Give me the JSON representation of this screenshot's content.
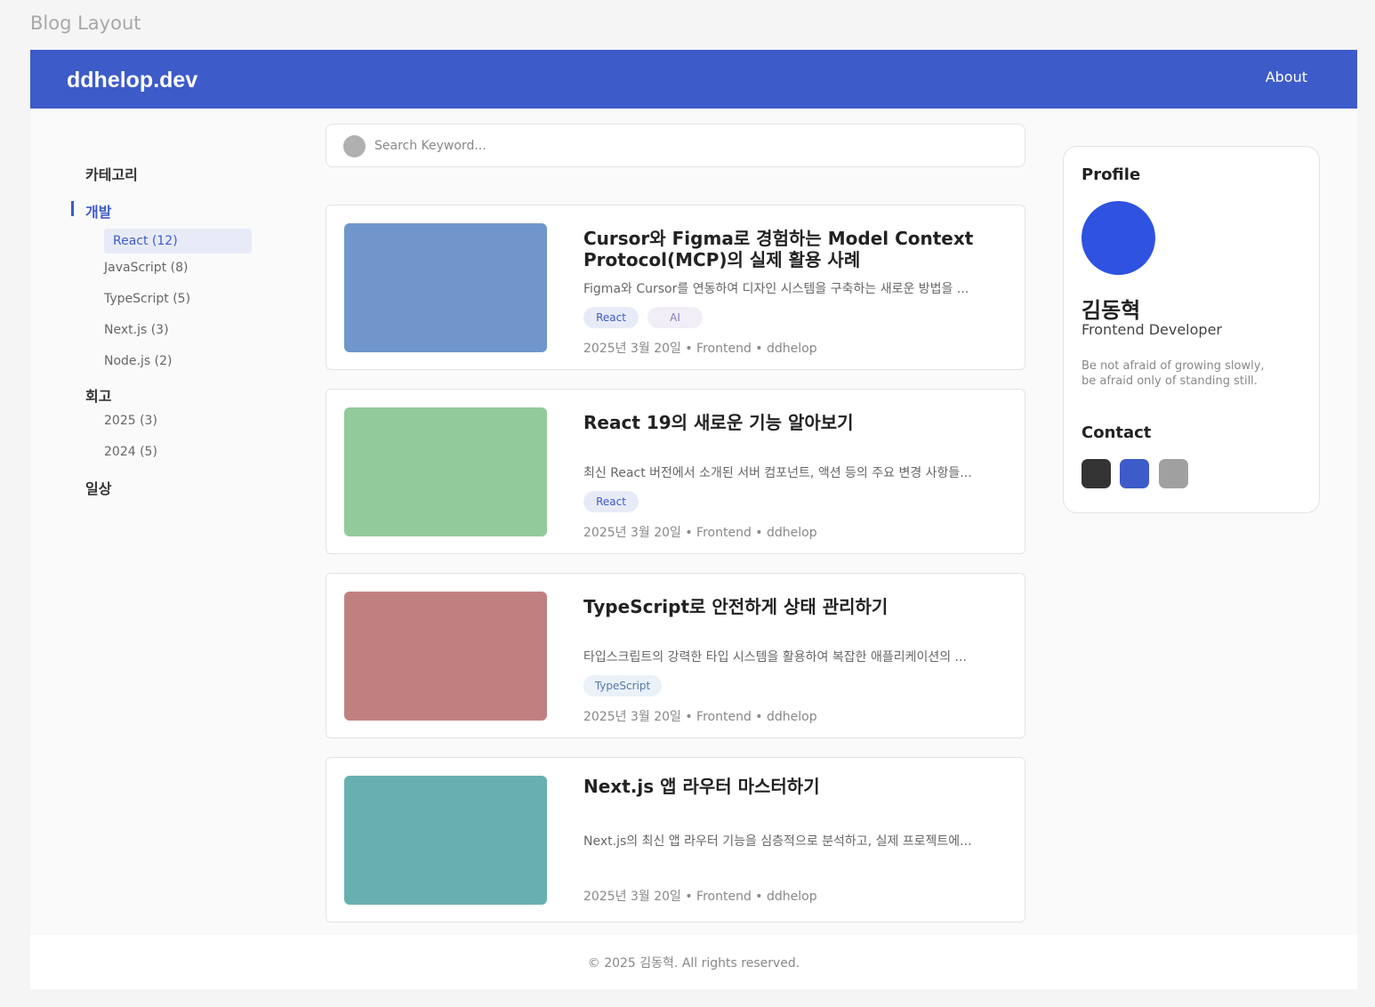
{
  "frame_title": "Blog Layout",
  "header": {
    "logo": "ddhelop.dev",
    "nav_about": "About",
    "color": "#3d5bc9"
  },
  "sidebar": {
    "title": "카테고리",
    "groups": [
      {
        "label": "개발",
        "active": true,
        "items": [
          {
            "label": "React (12)",
            "active": true
          },
          {
            "label": "JavaScript (8)"
          },
          {
            "label": "TypeScript (5)"
          },
          {
            "label": "Next.js (3)"
          },
          {
            "label": "Node.js (2)"
          }
        ]
      },
      {
        "label": "회고",
        "items": [
          {
            "label": "2025 (3)"
          },
          {
            "label": "2024 (5)"
          }
        ]
      },
      {
        "label": "일상",
        "items": []
      }
    ]
  },
  "search": {
    "placeholder": "Search Keyword..."
  },
  "posts": [
    {
      "title": "Cursor와 Figma로 경험하는 Model Context Protocol(MCP)의 실제 활용 사례",
      "excerpt": "Figma와 Cursor를 연동하여 디자인 시스템을 구축하는 새로운 방법을 ...",
      "tags": [
        "React",
        "AI"
      ],
      "meta": "2025년 3월 20일 • Frontend • ddhelop",
      "thumb_color": "#7096cb"
    },
    {
      "title": "React 19의 새로운 기능 알아보기",
      "excerpt": "최신 React 버전에서 소개된 서버 컴포넌트, 액션 등의 주요 변경 사항들...",
      "tags": [
        "React"
      ],
      "meta": "2025년 3월 20일 • Frontend • ddhelop",
      "thumb_color": "#93ca9b"
    },
    {
      "title": "TypeScript로 안전하게 상태 관리하기",
      "excerpt": "타입스크립트의 강력한 타입 시스템을 활용하여 복잡한 애플리케이션의 ...",
      "tags": [
        "TypeScript"
      ],
      "meta": "2025년 3월 20일 • Frontend • ddhelop",
      "thumb_color": "#c18080"
    },
    {
      "title": "Next.js 앱 라우터 마스터하기",
      "excerpt": "Next.js의 최신 앱 라우터 기능을 심층적으로 분석하고, 실제 프로젝트에...",
      "tags": [],
      "meta": "2025년 3월 20일 • Frontend • ddhelop",
      "thumb_color": "#68b0b0"
    }
  ],
  "profile": {
    "heading": "Profile",
    "name": "김동혁",
    "role": "Frontend Developer",
    "quote_line1": "Be not afraid of growing slowly,",
    "quote_line2": "be afraid only of standing still.",
    "avatar_color": "#2f52e0",
    "contact_heading": "Contact",
    "contacts": [
      {
        "icon": "github-icon",
        "color": "#333333"
      },
      {
        "icon": "linkedin-icon",
        "color": "#3d5bc9"
      },
      {
        "icon": "email-icon",
        "color": "#a0a0a0"
      }
    ]
  },
  "footer": {
    "text": "© 2025 김동혁. All rights reserved."
  }
}
